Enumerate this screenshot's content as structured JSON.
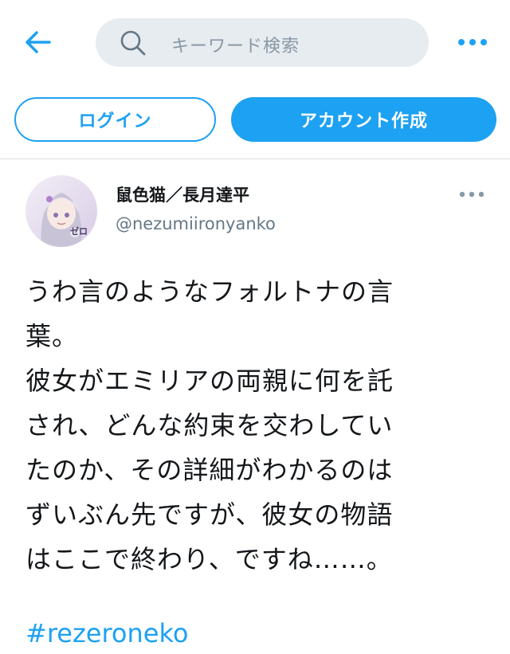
{
  "header": {
    "back_icon": "arrow-left-icon",
    "search": {
      "icon": "search-icon",
      "placeholder": "キーワード検索"
    },
    "more_icon": "more-horizontal-icon"
  },
  "auth": {
    "login_label": "ログイン",
    "signup_label": "アカウント作成"
  },
  "tweet": {
    "author": {
      "avatar": "avatar-image",
      "avatar_badge": "ゼロ",
      "display_name": "鼠色猫／長月達平",
      "handle": "@nezumiironyanko"
    },
    "more_icon": "more-horizontal-icon",
    "text_lines": [
      "うわ言のようなフォルトナの言",
      "葉。",
      "彼女がエミリアの両親に何を託",
      "され、どんな約束を交わしてい",
      "たのか、その詳細がわかるのは",
      "ずいぶん先ですが、彼女の物語",
      "はここで終わり、ですね……。"
    ],
    "hashtag": "#rezeroneko"
  },
  "colors": {
    "accent": "#1da1f2",
    "search_bg": "#e6ecf0",
    "secondary_text": "#657786",
    "primary_text": "#14171a"
  }
}
